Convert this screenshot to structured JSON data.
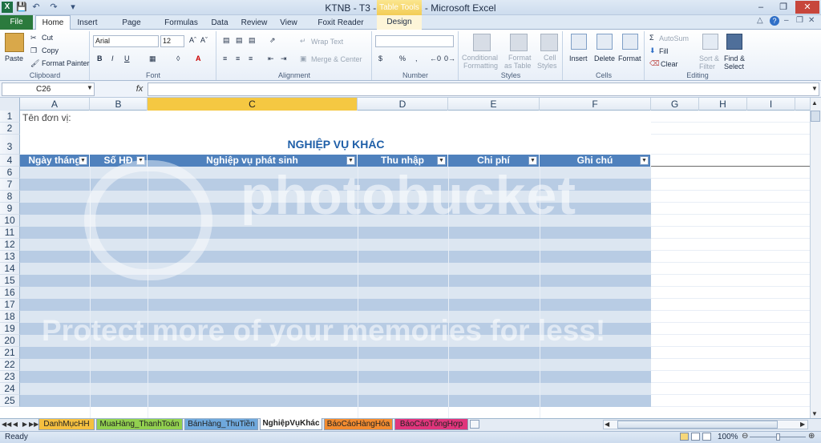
{
  "window": {
    "title": "KTNB - T3 - 01.14.xlsx - Microsoft Excel",
    "contextual_tab_title": "Table Tools",
    "icons": [
      "excel-logo-icon",
      "save-icon",
      "undo-icon",
      "redo-icon",
      "minimize-icon",
      "maximize-icon",
      "close-icon",
      "help-icon"
    ]
  },
  "ribbon_tabs": {
    "file": "File",
    "home": "Home",
    "insert": "Insert",
    "page_layout": "Page Layout",
    "formulas": "Formulas",
    "data": "Data",
    "review": "Review",
    "view": "View",
    "foxit": "Foxit Reader PDF",
    "design": "Design"
  },
  "ribbon": {
    "clipboard": {
      "group": "Clipboard",
      "paste": "Paste",
      "cut": "Cut",
      "copy": "Copy",
      "format_painter": "Format Painter"
    },
    "font": {
      "group": "Font",
      "font_name": "Arial",
      "font_size": "12"
    },
    "alignment": {
      "group": "Alignment",
      "wrap_text": "Wrap Text",
      "merge_center": "Merge & Center"
    },
    "number": {
      "group": "Number",
      "format": "",
      "currency": "$",
      "percent": "%",
      "comma": ","
    },
    "styles": {
      "group": "Styles",
      "conditional_1": "Conditional",
      "conditional_2": "Formatting",
      "format_table_1": "Format",
      "format_table_2": "as Table",
      "cell_styles_1": "Cell",
      "cell_styles_2": "Styles"
    },
    "cells": {
      "group": "Cells",
      "insert": "Insert",
      "delete": "Delete",
      "format": "Format"
    },
    "editing": {
      "group": "Editing",
      "autosum": "AutoSum",
      "fill": "Fill",
      "clear": "Clear",
      "sort_1": "Sort &",
      "sort_2": "Filter",
      "find_1": "Find &",
      "find_2": "Select"
    }
  },
  "formula_bar": {
    "name_box": "C26",
    "fx": "fx",
    "value": ""
  },
  "grid": {
    "columns": [
      "A",
      "B",
      "C",
      "D",
      "E",
      "F",
      "G",
      "H",
      "I"
    ],
    "selected_column": "C",
    "rows": [
      "1",
      "2",
      "3",
      "4",
      "5",
      "6",
      "7",
      "8",
      "9",
      "10",
      "11",
      "12",
      "13",
      "14",
      "15",
      "16",
      "17",
      "18",
      "19",
      "20",
      "21",
      "22",
      "23",
      "24",
      "25"
    ],
    "cells": {
      "A1": "Tên đơn vị:",
      "title": "NGHIỆP VỤ KHÁC"
    },
    "table_headers": [
      "Ngày tháng",
      "Số HĐ",
      "Nghiệp vụ phát sinh",
      "Thu nhập",
      "Chi phí",
      "Ghi chú"
    ],
    "table_style_colors": {
      "header": "#4f81bd",
      "band_dark": "#b8cce4",
      "band_light": "#dce6f1"
    }
  },
  "watermark": {
    "line1": "photobucket",
    "line2": "Protect more of your memories for less!"
  },
  "sheet_tabs": [
    {
      "label": "DanhMụcHH",
      "color": "#f5c040"
    },
    {
      "label": "MuaHàng_ThanhToán",
      "color": "#92d050"
    },
    {
      "label": "BánHàng_ThuTiền",
      "color": "#6fa8dc"
    },
    {
      "label": "NghiệpVụKhác",
      "color": "#ffffff",
      "active": true
    },
    {
      "label": "BáoCáoHàngHóa",
      "color": "#f28b30"
    },
    {
      "label": "BáoCáoTổngHợp",
      "color": "#e0357c"
    }
  ],
  "status_bar": {
    "ready": "Ready",
    "zoom": "100%"
  }
}
